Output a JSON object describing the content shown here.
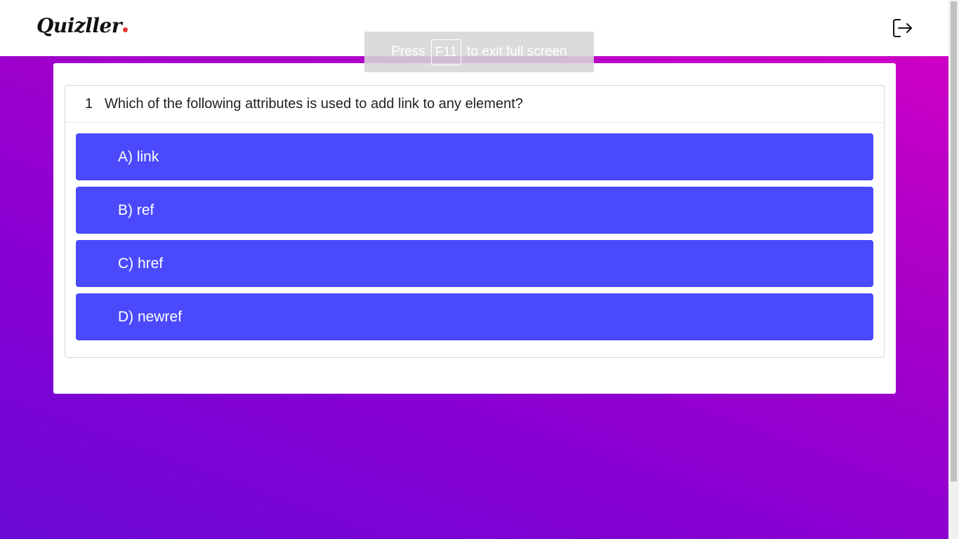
{
  "brand": {
    "name": "Quizller",
    "dot_color": "#e53935"
  },
  "header": {
    "logout_icon": "logout-icon"
  },
  "toast": {
    "pre": "Press",
    "key": "F11",
    "post": "to exit full screen"
  },
  "question": {
    "number": "1",
    "text": "Which of the following attributes is used to add link to any element?"
  },
  "options": [
    {
      "label": "A) link"
    },
    {
      "label": "B) ref"
    },
    {
      "label": "C) href"
    },
    {
      "label": "D) newref"
    }
  ],
  "colors": {
    "option_bg": "#4a4afc",
    "gradient_start": "#d600c6",
    "gradient_end": "#6a08d6"
  }
}
